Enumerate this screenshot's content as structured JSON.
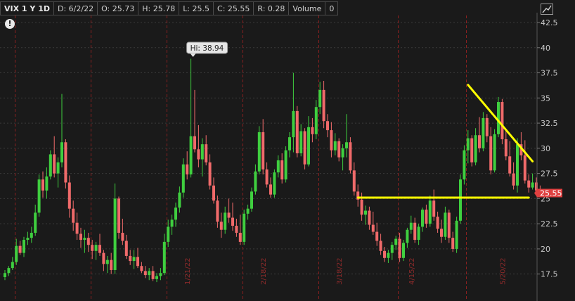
{
  "header": {
    "symbol": "VIX 1 Y 1D",
    "date": "D: 6/2/22",
    "open": "O: 25.73",
    "high": "H: 25.78",
    "low": "L: 25.5",
    "close": "C: 25.55",
    "range": "R: 0.28",
    "volume_label": "Volume",
    "volume_value": "0"
  },
  "alert_glyph": "!",
  "hi_callout": "Hi: 38.94",
  "last_price_label": "25.55",
  "colors": {
    "background": "#1a1a1a",
    "up": "#3fcf3f",
    "down": "#f06a6a",
    "grid": "#3a3a3a",
    "month_line": "#8a2020",
    "trendline": "#ffff00",
    "price_badge": "#e04040"
  },
  "chart_data": {
    "type": "candlestick",
    "title": "VIX 1 Y 1D",
    "ylim": [
      15.8,
      43.2
    ],
    "y_ticks": [
      "17.5",
      "20",
      "22.5",
      "25",
      "27.5",
      "30",
      "32.5",
      "35",
      "37.5",
      "40",
      "42.5"
    ],
    "x_date_labels": [
      {
        "label": "1/21/22",
        "index": 48
      },
      {
        "label": "2/18/22",
        "index": 68
      },
      {
        "label": "3/18/22",
        "index": 88
      },
      {
        "label": "4/15/22",
        "index": 107
      },
      {
        "label": "5/20/22",
        "index": 131
      }
    ],
    "month_boundaries": [
      3,
      23,
      43,
      63,
      83,
      104,
      122,
      146,
      166,
      188,
      210,
      230
    ],
    "last_price": 25.55,
    "high_annotation": {
      "label": "Hi: 38.94",
      "value": 38.94
    },
    "trendlines": [
      {
        "from": {
          "index": 93,
          "value": 25.1
        },
        "to": {
          "index": 138,
          "value": 25.1
        }
      },
      {
        "from": {
          "index": 122,
          "value": 36.3
        },
        "to": {
          "index": 139,
          "value": 28.7
        }
      }
    ],
    "candles": [
      [
        17.2,
        17.9,
        16.9,
        17.6
      ],
      [
        17.6,
        18.3,
        17.3,
        18.1
      ],
      [
        18.1,
        19.2,
        17.9,
        18.7
      ],
      [
        18.7,
        21.0,
        18.4,
        20.3
      ],
      [
        20.3,
        20.8,
        19.4,
        19.6
      ],
      [
        19.6,
        21.2,
        19.2,
        20.9
      ],
      [
        20.9,
        21.7,
        20.4,
        21.1
      ],
      [
        21.1,
        22.2,
        20.6,
        21.6
      ],
      [
        21.6,
        24.4,
        21.3,
        23.6
      ],
      [
        23.6,
        27.4,
        23.2,
        26.9
      ],
      [
        26.9,
        27.7,
        25.1,
        25.8
      ],
      [
        25.8,
        28.1,
        25.0,
        27.2
      ],
      [
        27.2,
        29.8,
        26.9,
        29.4
      ],
      [
        29.4,
        31.2,
        27.1,
        27.5
      ],
      [
        27.5,
        29.1,
        26.1,
        28.6
      ],
      [
        28.6,
        35.4,
        28.1,
        30.6
      ],
      [
        30.6,
        30.9,
        26.0,
        26.6
      ],
      [
        26.6,
        27.3,
        23.1,
        24.0
      ],
      [
        24.0,
        24.8,
        21.8,
        22.6
      ],
      [
        22.6,
        23.6,
        20.9,
        21.5
      ],
      [
        21.5,
        22.1,
        20.1,
        20.9
      ],
      [
        20.9,
        21.9,
        19.6,
        21.1
      ],
      [
        21.1,
        21.6,
        19.7,
        20.4
      ],
      [
        20.4,
        20.9,
        19.0,
        19.8
      ],
      [
        19.8,
        20.7,
        18.9,
        20.4
      ],
      [
        20.4,
        21.5,
        19.3,
        19.6
      ],
      [
        19.6,
        19.9,
        17.8,
        18.5
      ],
      [
        18.5,
        19.3,
        17.6,
        18.9
      ],
      [
        18.9,
        19.6,
        17.5,
        17.9
      ],
      [
        17.9,
        26.5,
        17.5,
        25.0
      ],
      [
        25.0,
        25.2,
        21.0,
        21.6
      ],
      [
        21.6,
        23.0,
        20.4,
        20.8
      ],
      [
        20.8,
        21.4,
        19.0,
        19.3
      ],
      [
        19.3,
        19.9,
        18.4,
        18.8
      ],
      [
        18.8,
        19.9,
        18.0,
        19.2
      ],
      [
        19.2,
        20.1,
        18.1,
        18.3
      ],
      [
        18.3,
        18.7,
        17.6,
        17.8
      ],
      [
        17.8,
        18.3,
        17.1,
        17.4
      ],
      [
        17.4,
        18.1,
        16.9,
        17.8
      ],
      [
        17.8,
        18.3,
        16.8,
        17.0
      ],
      [
        17.0,
        17.6,
        16.7,
        17.3
      ],
      [
        17.3,
        18.1,
        16.9,
        17.6
      ],
      [
        17.6,
        21.5,
        17.4,
        20.7
      ],
      [
        20.7,
        22.9,
        20.2,
        22.2
      ],
      [
        22.2,
        23.4,
        21.4,
        22.9
      ],
      [
        22.9,
        24.6,
        22.2,
        24.1
      ],
      [
        24.1,
        26.2,
        23.6,
        25.6
      ],
      [
        25.6,
        29.0,
        25.1,
        28.4
      ],
      [
        28.4,
        29.7,
        26.9,
        27.4
      ],
      [
        27.4,
        38.9,
        27.1,
        31.2
      ],
      [
        31.2,
        35.8,
        29.6,
        29.9
      ],
      [
        29.9,
        32.3,
        28.1,
        28.9
      ],
      [
        28.9,
        31.0,
        27.2,
        30.4
      ],
      [
        30.4,
        31.3,
        28.3,
        28.6
      ],
      [
        28.6,
        29.4,
        25.9,
        26.3
      ],
      [
        26.3,
        27.1,
        24.5,
        24.8
      ],
      [
        24.8,
        25.3,
        22.1,
        22.7
      ],
      [
        22.7,
        23.6,
        21.1,
        21.9
      ],
      [
        21.9,
        24.2,
        21.5,
        23.6
      ],
      [
        23.6,
        25.0,
        22.6,
        23.1
      ],
      [
        23.1,
        24.6,
        21.8,
        22.3
      ],
      [
        22.3,
        23.0,
        21.2,
        21.6
      ],
      [
        21.6,
        23.4,
        20.4,
        20.7
      ],
      [
        20.7,
        23.9,
        20.4,
        23.5
      ],
      [
        23.5,
        24.4,
        22.9,
        24.0
      ],
      [
        24.0,
        26.1,
        23.7,
        25.7
      ],
      [
        25.7,
        28.4,
        25.4,
        27.7
      ],
      [
        27.7,
        32.2,
        27.4,
        31.6
      ],
      [
        31.6,
        32.9,
        27.4,
        27.9
      ],
      [
        27.9,
        28.6,
        26.1,
        26.4
      ],
      [
        26.4,
        27.1,
        25.1,
        25.4
      ],
      [
        25.4,
        27.9,
        25.1,
        27.6
      ],
      [
        27.6,
        29.3,
        27.1,
        28.8
      ],
      [
        28.8,
        29.5,
        26.5,
        26.9
      ],
      [
        26.9,
        30.2,
        26.6,
        29.8
      ],
      [
        29.8,
        31.6,
        29.1,
        31.1
      ],
      [
        31.1,
        37.5,
        29.6,
        33.7
      ],
      [
        33.7,
        34.2,
        29.1,
        29.5
      ],
      [
        29.5,
        32.4,
        29.2,
        31.7
      ],
      [
        31.7,
        32.0,
        27.9,
        28.4
      ],
      [
        28.4,
        33.2,
        28.2,
        32.1
      ],
      [
        32.1,
        33.0,
        30.6,
        31.4
      ],
      [
        31.4,
        34.8,
        30.9,
        34.1
      ],
      [
        34.1,
        36.6,
        33.4,
        35.8
      ],
      [
        35.8,
        36.7,
        32.0,
        32.7
      ],
      [
        32.7,
        33.4,
        31.1,
        31.8
      ],
      [
        31.8,
        32.6,
        29.1,
        29.8
      ],
      [
        29.8,
        31.5,
        29.3,
        30.7
      ],
      [
        30.7,
        31.0,
        28.7,
        29.1
      ],
      [
        29.1,
        30.4,
        27.8,
        30.0
      ],
      [
        30.0,
        33.4,
        29.1,
        30.6
      ],
      [
        30.6,
        31.1,
        27.5,
        27.8
      ],
      [
        27.8,
        28.6,
        25.3,
        25.7
      ],
      [
        25.7,
        26.4,
        24.2,
        24.9
      ],
      [
        24.9,
        25.6,
        22.8,
        23.4
      ],
      [
        23.4,
        24.3,
        22.4,
        23.8
      ],
      [
        23.8,
        24.2,
        21.9,
        22.4
      ],
      [
        22.4,
        23.7,
        21.4,
        21.7
      ],
      [
        21.7,
        22.6,
        20.3,
        20.8
      ],
      [
        20.8,
        21.5,
        19.4,
        19.8
      ],
      [
        19.8,
        20.2,
        18.7,
        19.1
      ],
      [
        19.1,
        19.9,
        18.6,
        19.6
      ],
      [
        19.6,
        20.7,
        18.9,
        20.4
      ],
      [
        20.4,
        21.3,
        19.9,
        21.0
      ],
      [
        21.0,
        21.6,
        18.7,
        19.1
      ],
      [
        19.1,
        20.9,
        18.8,
        20.6
      ],
      [
        20.6,
        22.1,
        20.1,
        21.9
      ],
      [
        21.9,
        23.3,
        21.5,
        22.6
      ],
      [
        22.6,
        23.1,
        20.6,
        20.9
      ],
      [
        20.9,
        22.5,
        20.4,
        22.2
      ],
      [
        22.2,
        24.1,
        21.7,
        23.9
      ],
      [
        23.9,
        24.4,
        22.1,
        22.5
      ],
      [
        22.5,
        25.3,
        22.2,
        24.8
      ],
      [
        24.8,
        25.9,
        22.8,
        23.2
      ],
      [
        23.2,
        23.7,
        21.6,
        22.0
      ],
      [
        22.0,
        22.9,
        20.6,
        21.2
      ],
      [
        21.2,
        24.2,
        20.9,
        23.6
      ],
      [
        23.6,
        23.9,
        20.6,
        21.1
      ],
      [
        21.1,
        21.7,
        19.7,
        20.0
      ],
      [
        20.0,
        23.2,
        19.6,
        22.8
      ],
      [
        22.8,
        27.4,
        22.5,
        26.9
      ],
      [
        26.9,
        30.3,
        26.4,
        29.8
      ],
      [
        29.8,
        31.8,
        28.5,
        31.0
      ],
      [
        31.0,
        31.3,
        28.2,
        28.6
      ],
      [
        28.6,
        32.0,
        28.3,
        31.3
      ],
      [
        31.3,
        33.1,
        29.6,
        30.0
      ],
      [
        30.0,
        33.6,
        29.7,
        33.0
      ],
      [
        33.0,
        33.4,
        30.6,
        31.2
      ],
      [
        31.2,
        32.1,
        27.4,
        27.8
      ],
      [
        27.8,
        31.9,
        27.6,
        31.4
      ],
      [
        31.4,
        35.1,
        31.1,
        34.6
      ],
      [
        34.6,
        34.9,
        30.4,
        30.9
      ],
      [
        30.9,
        31.7,
        28.8,
        29.2
      ],
      [
        29.2,
        30.7,
        27.2,
        27.5
      ],
      [
        27.5,
        28.6,
        25.9,
        26.3
      ],
      [
        26.3,
        31.0,
        25.6,
        30.4
      ],
      [
        30.4,
        31.6,
        28.8,
        29.3
      ],
      [
        29.3,
        30.8,
        26.5,
        26.8
      ],
      [
        26.8,
        27.4,
        25.6,
        26.1
      ],
      [
        26.1,
        27.5,
        25.9,
        26.6
      ],
      [
        26.6,
        27.1,
        25.5,
        25.8
      ],
      [
        25.8,
        26.3,
        25.4,
        25.6
      ],
      [
        25.73,
        25.78,
        25.5,
        25.55
      ]
    ]
  }
}
